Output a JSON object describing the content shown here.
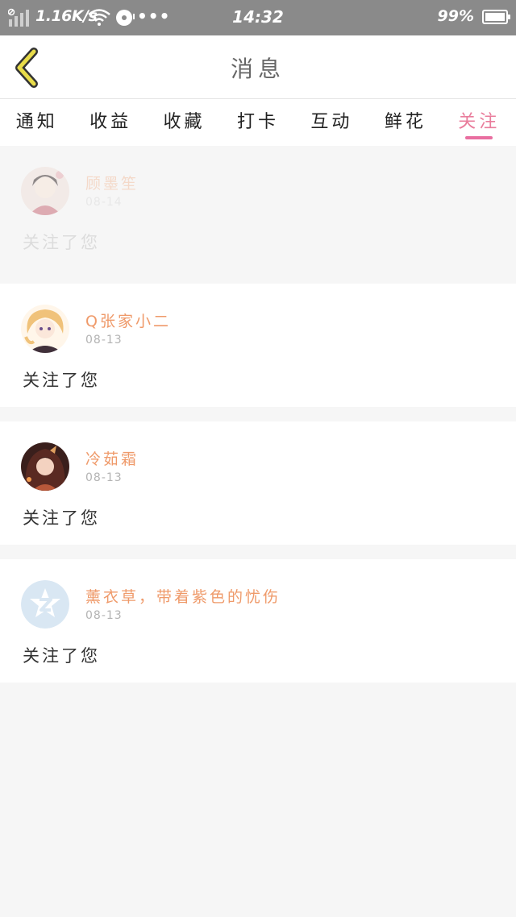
{
  "status_bar": {
    "network_speed": "1.16K/s",
    "more_indicator": "•••",
    "time": "14:32",
    "battery": "99%",
    "icons": [
      "signal-icon",
      "wifi-icon",
      "disc-icon",
      "battery-icon"
    ]
  },
  "header": {
    "title": "消息",
    "back_icon": "back-chevron-icon"
  },
  "tabs": [
    {
      "label": "通知"
    },
    {
      "label": "收益"
    },
    {
      "label": "收藏"
    },
    {
      "label": "打卡"
    },
    {
      "label": "互动"
    },
    {
      "label": "鲜花"
    },
    {
      "label": "关注",
      "active": true
    }
  ],
  "notifications": [
    {
      "username": "顾墨笙",
      "date": "08-14",
      "message": "关注了您",
      "faded": true,
      "avatar": "anime-portrait-avatar"
    },
    {
      "username": "Q张家小二",
      "date": "08-13",
      "message": "关注了您",
      "faded": false,
      "avatar": "anime-portrait-avatar"
    },
    {
      "username": "冷茹霜",
      "date": "08-13",
      "message": "关注了您",
      "faded": false,
      "avatar": "anime-portrait-avatar"
    },
    {
      "username": "薰衣草，带着紫色的忧伤",
      "date": "08-13",
      "message": "关注了您",
      "faded": false,
      "avatar": "default-avatar-icon"
    }
  ],
  "colors": {
    "accent": "#e96ea0",
    "username": "#ef9a6a",
    "status_bar": "#8a8a8a",
    "back_icon": "#e8dc4a"
  }
}
